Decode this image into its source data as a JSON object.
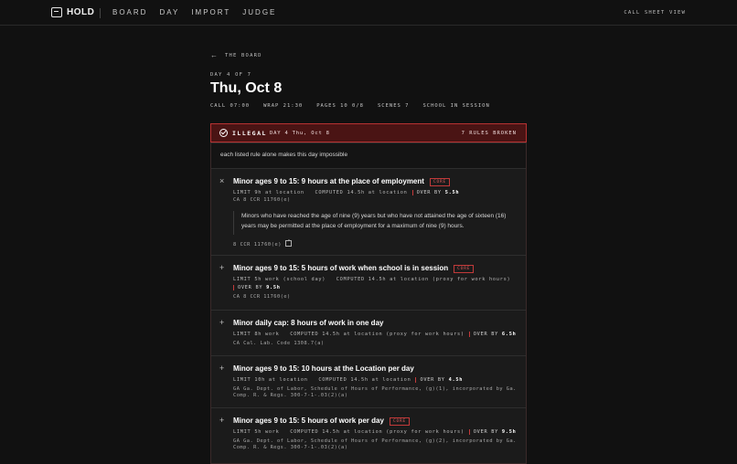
{
  "topbar": {
    "brand": "HOLD",
    "nav": [
      "BOARD",
      "DAY",
      "IMPORT",
      "JUDGE"
    ],
    "right_link": "CALL SHEET VIEW"
  },
  "page": {
    "back_label": "THE BOARD",
    "eyebrow": "DAY 4 OF 7",
    "title": "Thu, Oct 8",
    "stats": [
      "CALL 07:00",
      "WRAP 21:30",
      "PAGES 10 0/8",
      "SCENES 7",
      "SCHOOL IN SESSION"
    ]
  },
  "banner": {
    "label": "ILLEGAL",
    "day": "DAY 4 Thu, Oct 8",
    "count": "7 RULES BROKEN",
    "summary": "each listed rule alone makes this day impossible",
    "colors": {
      "fill": "#4a1414",
      "border": "#b83232"
    }
  },
  "rules": [
    {
      "toggle": "×",
      "title": "Minor ages 9 to 15: 9 hours at the place of employment",
      "badge": "CORE",
      "limit": "LIMIT 9h at location",
      "computed": "COMPUTED 14.5h at location",
      "over_prefix": "OVER BY",
      "over_value": "5.5h",
      "citation": "CA 8 CCR 11760(e)",
      "quote": "Minors who have reached the age of nine (9) years but who have not attained the age of sixteen (16) years may be permitted at the place of employment for a maximum of nine (9) hours.",
      "link": "8 CCR 11760(e)"
    },
    {
      "toggle": "+",
      "title": "Minor ages 9 to 15: 5 hours of work when school is in session",
      "badge": "CORE",
      "limit": "LIMIT 5h work (school day)",
      "computed": "COMPUTED 14.5h at location (proxy for work hours)",
      "over_prefix": "OVER BY",
      "over_value": "9.5h",
      "citation": "CA 8 CCR 11760(e)"
    },
    {
      "toggle": "+",
      "title": "Minor daily cap: 8 hours of work in one day",
      "limit": "LIMIT 8h work",
      "computed": "COMPUTED 14.5h at location (proxy for work hours)",
      "over_prefix": "OVER BY",
      "over_value": "6.5h",
      "citation": "CA Cal. Lab. Code 1308.7(a)"
    },
    {
      "toggle": "+",
      "title": "Minor ages 9 to 15: 10 hours at the Location per day",
      "limit": "LIMIT 10h at location",
      "computed": "COMPUTED 14.5h at location",
      "over_prefix": "OVER BY",
      "over_value": "4.5h",
      "citation": "GA Ga. Dept. of Labor, Schedule of Hours of Performance, (g)(1), incorporated by Ga. Comp. R. & Regs. 300-7-1-.03(2)(a)"
    },
    {
      "toggle": "+",
      "title": "Minor ages 9 to 15: 5 hours of work per day",
      "badge": "CORE",
      "limit": "LIMIT 5h work",
      "computed": "COMPUTED 14.5h at location (proxy for work hours)",
      "over_prefix": "OVER BY",
      "over_value": "9.5h",
      "citation": "GA Ga. Dept. of Labor, Schedule of Hours of Performance, (g)(2), incorporated by Ga. Comp. R. & Regs. 300-7-1-.03(2)(a)"
    }
  ]
}
